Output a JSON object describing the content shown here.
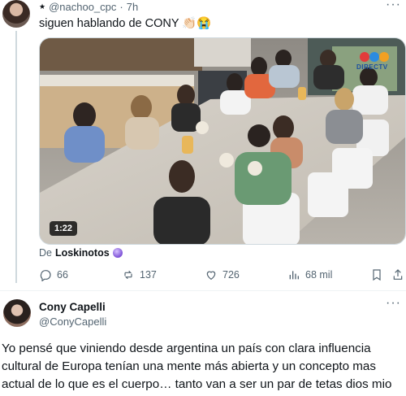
{
  "post1": {
    "handle": "@nachoo_cpc",
    "separator": "·",
    "time": "7h",
    "text": "siguen hablando de CONY 👏🏻😭",
    "video": {
      "duration": "1:22",
      "broadcaster_logo_text": "DIRECTV"
    },
    "attribution_prefix": "De",
    "attribution_name": "Loskinotos",
    "actions": {
      "replies": "66",
      "reposts": "137",
      "likes": "726",
      "views": "68 mil"
    }
  },
  "post2": {
    "name": "Cony Capelli",
    "handle": "@ConyCapelli",
    "text": "Yo pensé que viniendo desde argentina un país con clara influencia cultural de Europa tenían una mente más abierta y un concepto mas actual de lo que es el cuerpo…  tanto van a ser un par de tetas dios mio"
  },
  "icons": {
    "verified": "star-icon",
    "reply": "reply-icon",
    "repost": "repost-icon",
    "like": "heart-icon",
    "views": "views-icon",
    "bookmark": "bookmark-icon",
    "share": "share-icon",
    "more": "more-icon"
  },
  "colors": {
    "text": "#0f1419",
    "muted": "#536471",
    "border": "#cfd9de"
  }
}
